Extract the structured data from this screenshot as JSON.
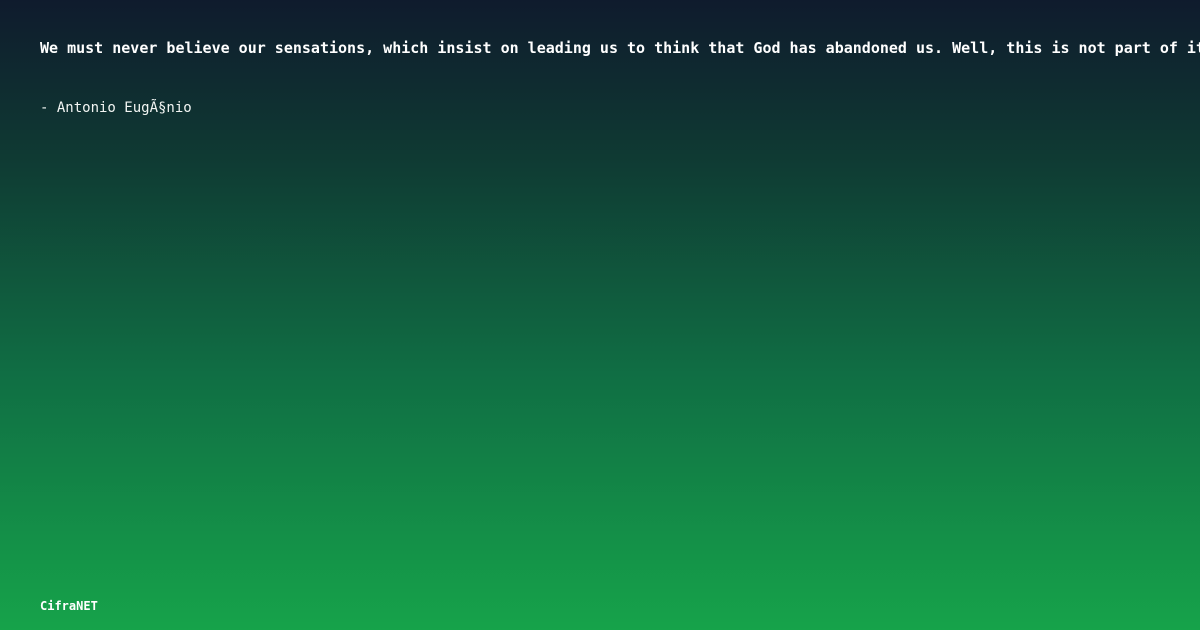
{
  "quote": {
    "text": "We must never believe our sensations, which insist on leading us to think that God has abandoned us. Well, this is not part of it",
    "author": "- Antonio EugÃ§nio"
  },
  "brand": {
    "name": "CifraNET"
  },
  "colors": {
    "gradient_top": "#0f1b2d",
    "gradient_bottom": "#16a34a",
    "text": "#ffffff"
  }
}
